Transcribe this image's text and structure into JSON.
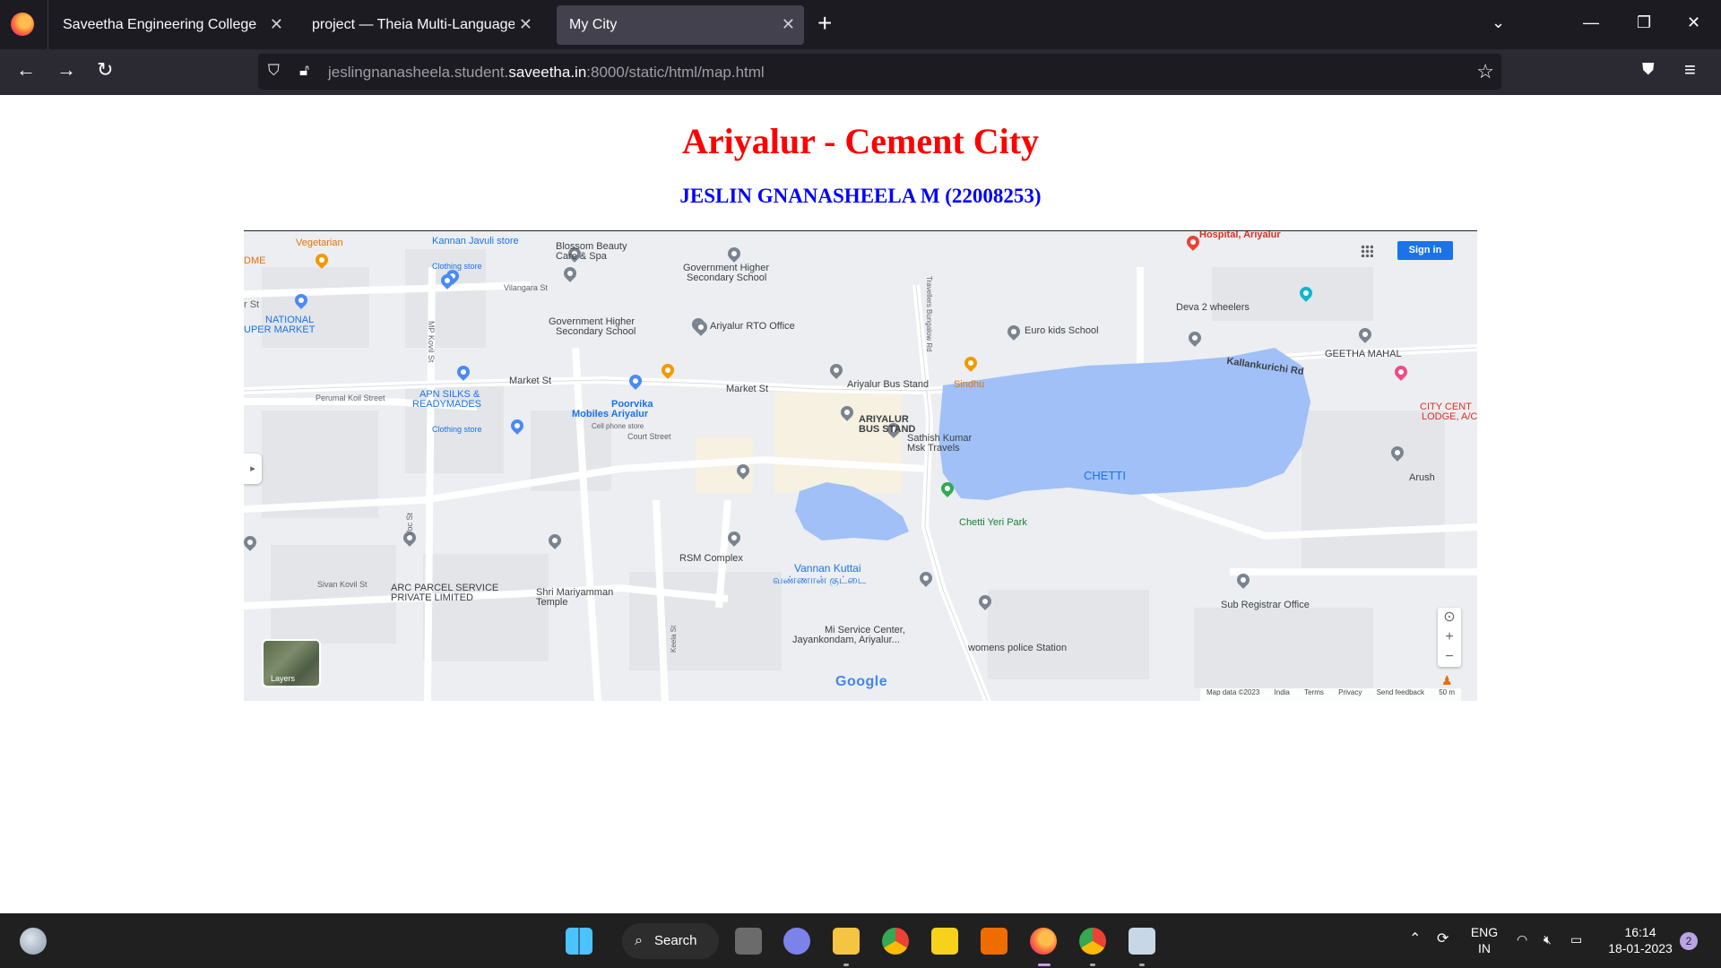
{
  "browser": {
    "tabs": [
      {
        "title": "Saveetha Engineering College"
      },
      {
        "title": "project — Theia Multi-Language Ex"
      },
      {
        "title": "My City"
      }
    ],
    "url_prefix": "jeslingnanasheela.student.",
    "url_domain": "saveetha.in",
    "url_suffix": ":8000/static/html/map.html"
  },
  "page": {
    "title": "Ariyalur - Cement City",
    "subtitle": "JESLIN GNANASHEELA M (22008253)"
  },
  "map": {
    "sign_in": "Sign in",
    "layers": "Layers",
    "google": "Google",
    "lake_name": "CHETTI",
    "pond_name": "Vannan Kuttai",
    "pond_tamil": "வண்ணான் குட்டை",
    "attribution": [
      "Map data ©2023",
      "India",
      "Terms",
      "Privacy",
      "Send feedback",
      "50 m"
    ],
    "labels": {
      "hospital": "Hospital, Ariyalur",
      "kannan": "Kannan Javuli store",
      "blossom": "Blossom Beauty",
      "blossom2": "Care & Spa",
      "govt_school": "Government Higher",
      "govt_school2": "Secondary School",
      "govt_school_b": "Government Higher",
      "govt_school_b2": "Secondary School",
      "vilangara": "Vilangara St",
      "national": "NATIONAL",
      "national2": "UPER MARKET",
      "rto": "Ariyalur RTO Office",
      "deva": "Deva 2 wheelers",
      "euro": "Euro kids School",
      "geetha": "GEETHA MAHAL",
      "kallankurichi": "Kallankurichi Rd",
      "market_st": "Market St",
      "market_st2": "Market St",
      "bus_stand": "Ariyalur Bus Stand",
      "sindhu": "Sindhu",
      "city_cent": "CITY CENT",
      "city_cent2": "LODGE, A/C",
      "apn": "APN SILKS &",
      "apn2": "READYMADES",
      "perumal": "Perumal Koil Street",
      "poorvika": "Poorvika",
      "poorvika2": "Mobiles Ariyalur",
      "poorvika3": "Cell phone store",
      "ariyalur_bs": "ARIYALUR",
      "ariyalur_bs2": "BUS STAND",
      "court": "Court Street",
      "sathish": "Sathish Kumar",
      "sathish2": "Msk Travels",
      "arush": "Arush",
      "chetti_park": "Chetti Yeri Park",
      "rsm": "RSM Complex",
      "arc": "ARC PARCEL SERVICE",
      "arc2": "PRIVATE LIMITED",
      "sivan": "Sivan Kovil St",
      "mariyamman": "Shri Mariyamman",
      "mariyamman2": "Temple",
      "voc": "Voc St",
      "mp_kovil": "MP Kovil St",
      "travellers": "Travellers Bungalow Rd",
      "keela": "Keela St",
      "sub_reg": "Sub Registrar Office",
      "mi": "Mi Service Center,",
      "mi2": "Jayankondam, Ariyalur...",
      "womens": "womens police Station",
      "vegetarian": "Vegetarian",
      "dme": "DME",
      "rst": "r St",
      "clothing": "Clothing store",
      "clothing2": "Clothing store"
    }
  },
  "taskbar": {
    "search": "Search",
    "lang1": "ENG",
    "lang2": "IN",
    "time": "16:14",
    "date": "18-01-2023",
    "badge": "2"
  }
}
